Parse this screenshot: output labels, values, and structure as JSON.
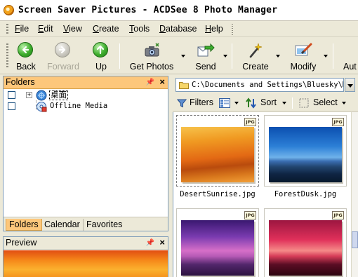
{
  "window": {
    "title": "Screen Saver Pictures - ACDSee 8 Photo Manager"
  },
  "menu": {
    "items": [
      "File",
      "Edit",
      "View",
      "Create",
      "Tools",
      "Database",
      "Help"
    ]
  },
  "toolbar": {
    "back": "Back",
    "forward": "Forward",
    "up": "Up",
    "get_photos": "Get Photos",
    "send": "Send",
    "create": "Create",
    "modify": "Modify",
    "auto": "Aut"
  },
  "folders_pane": {
    "title": "Folders",
    "tree": [
      {
        "label": "桌面"
      },
      {
        "label": "Offline Media"
      }
    ],
    "tabs": [
      "Folders",
      "Calendar",
      "Favorites"
    ]
  },
  "preview_pane": {
    "title": "Preview"
  },
  "address": {
    "path": "C:\\Documents and Settings\\Bluesky\\My"
  },
  "filter_bar": {
    "filters": "Filters",
    "sort": "Sort",
    "select": "Select"
  },
  "files": [
    {
      "name": "DesertSunrise.jpg",
      "badge": "JPG",
      "selected": true
    },
    {
      "name": "ForestDusk.jpg",
      "badge": "JPG",
      "selected": false
    },
    {
      "name": "",
      "badge": "JPG",
      "selected": false
    },
    {
      "name": "",
      "badge": "JPG",
      "selected": false
    }
  ]
}
